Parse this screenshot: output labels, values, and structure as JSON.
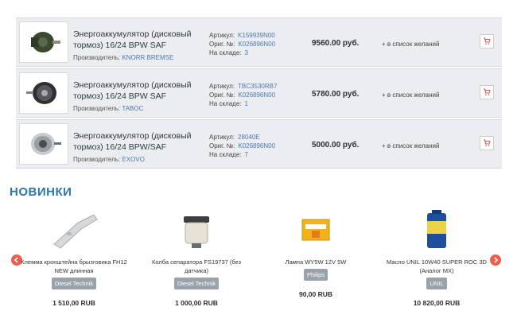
{
  "products": [
    {
      "title": "Энергоаккумулятор (дисковый тормоз) 16/24 BPW SAF",
      "maker_label": "Производитель:",
      "maker": "KNORR BREMSE",
      "article_label": "Артикул:",
      "article": "K159939N00",
      "orig_label": "Ориг. №:",
      "orig": "K026896N00",
      "stock_label": "На складе:",
      "stock": "3",
      "price": "9560.00 руб.",
      "wish": "+ в список желаний"
    },
    {
      "title": "Энергоаккумулятор (дисковый тормоз) 16/24 BPW SAF",
      "maker_label": "Производитель:",
      "maker": "TABOC",
      "article_label": "Артикул:",
      "article": "TBC3530RB7",
      "orig_label": "Ориг. №:",
      "orig": "K026896N00",
      "stock_label": "На складе:",
      "stock": "1",
      "price": "5780.00 руб.",
      "wish": "+ в список желаний"
    },
    {
      "title": "Энергоаккумулятор (дисковый тормоз) 16/24 BPW/SAF",
      "maker_label": "Производитель:",
      "maker": "EXOVO",
      "article_label": "Артикул:",
      "article": "28040E",
      "orig_label": "Ориг. №:",
      "orig": "K026896N00",
      "stock_label": "На складе:",
      "stock": "7",
      "price": "5000.00 руб.",
      "wish": "+ в список желаний"
    }
  ],
  "new_section": {
    "title": "НОВИНКИ"
  },
  "new_items": [
    {
      "name": "Клемма кронштейна брызговика FH12 NEW длинная",
      "brand": "Diesel Technik",
      "price": "1 510,00 RUB"
    },
    {
      "name": "Колба сепаратора FS19737 (без датчика)",
      "brand": "Diesel Technik",
      "price": "1 000,00 RUB"
    },
    {
      "name": "Лампа WY5W 12V 5W",
      "brand": "Philips",
      "price": "90,00 RUB"
    },
    {
      "name": "Масло UNIL 10W40 SUPER ROC 3D (Аналог MX)",
      "brand": "UNIL",
      "price": "10 820,00 RUB"
    }
  ],
  "colors": {
    "accent": "#2f74a8",
    "arrow": "#ea6050",
    "cart": "#d9534f",
    "link": "#4a7ab3"
  },
  "icons": {
    "cart": "cart-icon",
    "prev": "chevron-left-icon",
    "next": "chevron-right-icon"
  }
}
